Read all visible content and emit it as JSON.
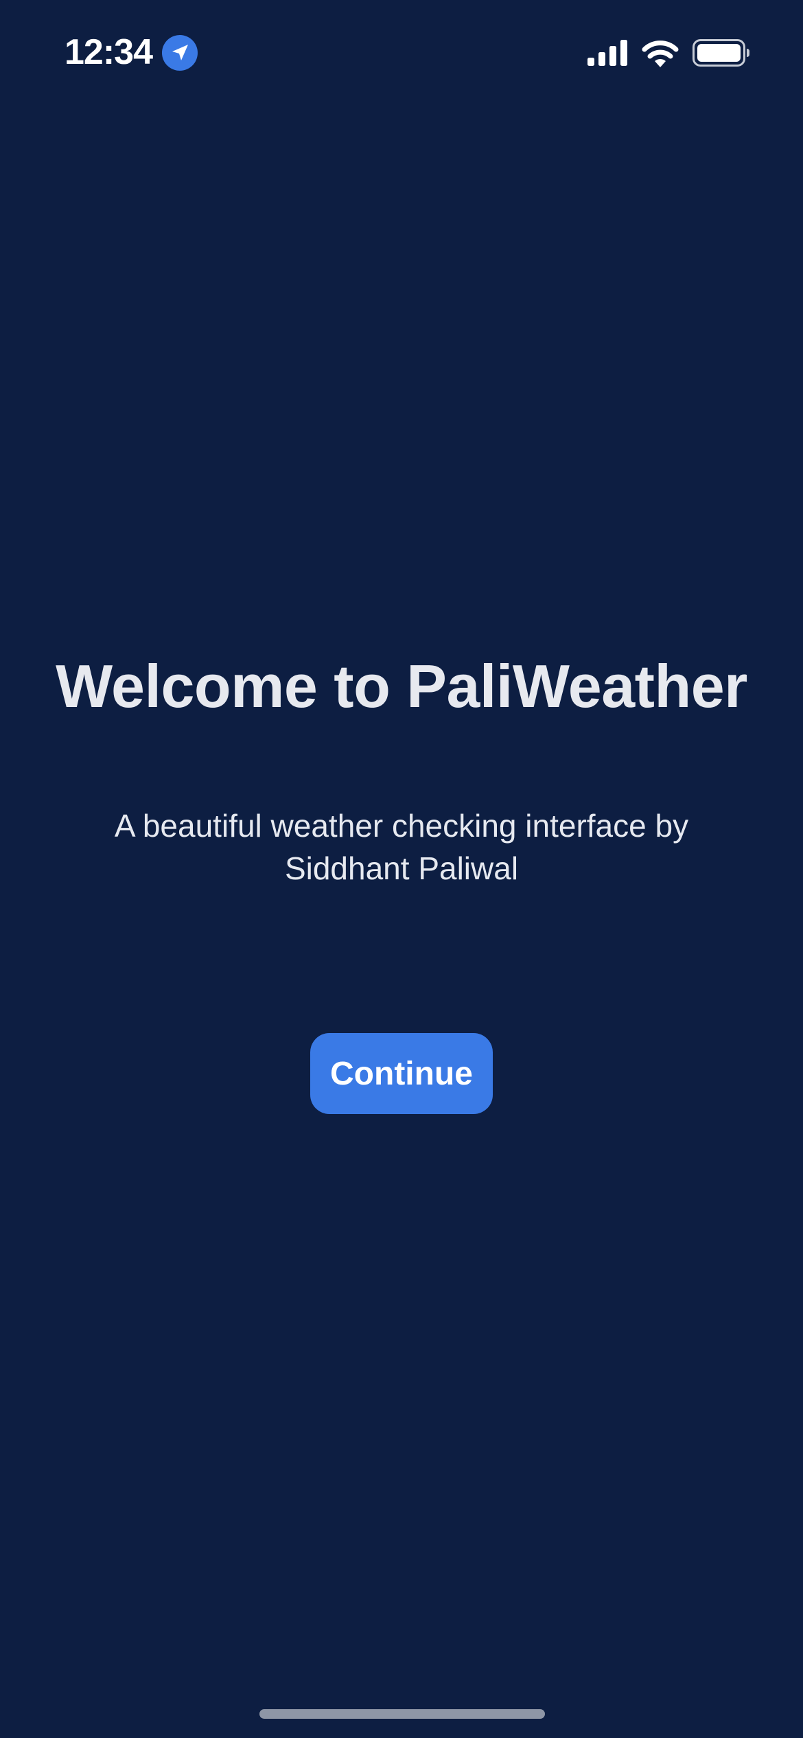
{
  "status_bar": {
    "time": "12:34",
    "icons": [
      "location-arrow-icon",
      "cellular-signal-icon",
      "wifi-icon",
      "battery-icon"
    ],
    "accent_color": "#3a7ae6"
  },
  "welcome": {
    "title": "Welcome to PaliWeather",
    "subtitle": "A beautiful weather checking interface by Siddhant Paliwal",
    "continue_label": "Continue"
  },
  "colors": {
    "background": "#0d1e42",
    "button": "#3a7ae6",
    "text": "#e6e9f0"
  }
}
